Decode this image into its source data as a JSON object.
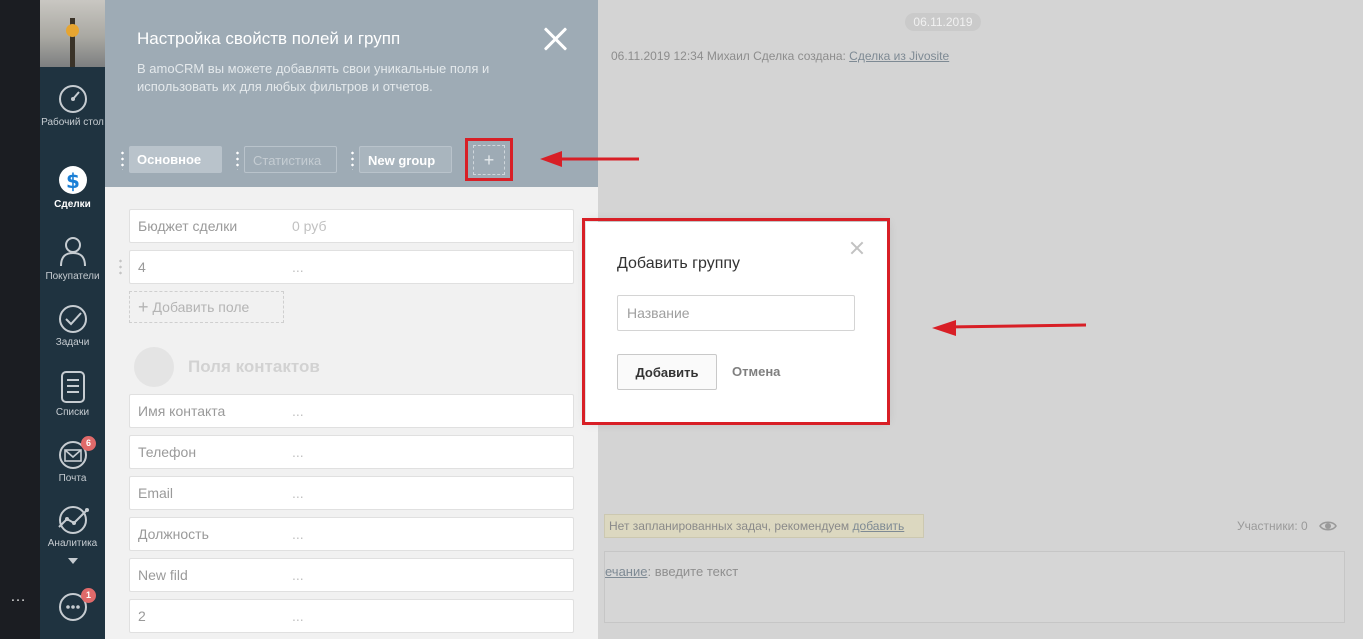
{
  "colors": {
    "accent_red": "#d81f26",
    "sidebar_bg": "#1f3340",
    "panel_header_bg": "#9eabb5",
    "badge_red": "#e06a6a"
  },
  "sidebar": {
    "more_icon": "…",
    "items": [
      {
        "label": "Рабочий стол",
        "icon": "dashboard-icon"
      },
      {
        "label": "Сделки",
        "icon": "deals-icon",
        "active": true
      },
      {
        "label": "Покупатели",
        "icon": "customers-icon"
      },
      {
        "label": "Задачи",
        "icon": "tasks-icon"
      },
      {
        "label": "Списки",
        "icon": "lists-icon"
      },
      {
        "label": "Почта",
        "icon": "mail-icon",
        "badge": "6"
      },
      {
        "label": "Аналитика",
        "icon": "analytics-icon"
      },
      {
        "label": "",
        "icon": "chat-icon",
        "badge": "1"
      }
    ]
  },
  "settings": {
    "title": "Настройка свойств полей и групп",
    "subtitle": "В amoCRM вы можете добавлять свои уникальные поля и использовать их для любых фильтров и отчетов.",
    "tabs": [
      {
        "label": "Основное"
      },
      {
        "label": "Статистика"
      },
      {
        "label": "New group"
      }
    ],
    "add_group_symbol": "+",
    "deal_fields": [
      {
        "name": "Бюджет сделки",
        "value": "0 руб"
      },
      {
        "name": "4",
        "value": "..."
      }
    ],
    "add_field_label": "Добавить поле",
    "contacts_title": "Поля контактов",
    "contact_fields": [
      {
        "name": "Имя контакта",
        "value": "..."
      },
      {
        "name": "Телефон",
        "value": "..."
      },
      {
        "name": "Email",
        "value": "..."
      },
      {
        "name": "Должность",
        "value": "..."
      },
      {
        "name": "New fild",
        "value": "..."
      },
      {
        "name": "2",
        "value": "..."
      }
    ]
  },
  "background": {
    "date_pill": "06.11.2019",
    "log_prefix": "06.11.2019 12:34 Михаил  Сделка создана: ",
    "log_link": "Сделка из Jivosite",
    "tasks_text": "Нет запланированных задач, рекомендуем ",
    "tasks_link": "добавить",
    "participants": "Участники: 0",
    "note_link": "ечание",
    "note_text": ": введите текст"
  },
  "modal": {
    "title": "Добавить группу",
    "input_placeholder": "Название",
    "input_value": "",
    "add_label": "Добавить",
    "cancel_label": "Отмена"
  }
}
